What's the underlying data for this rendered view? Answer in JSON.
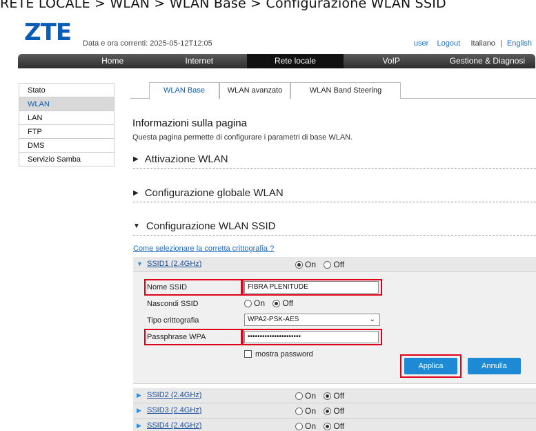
{
  "breadcrumb": "RETE LOCALE > WLAN > WLAN Base > Configurazione WLAN SSID",
  "logo": "ZTE",
  "datetime": "Data e ora correnti: 2025-05-12T12:05",
  "toplinks": {
    "user": "user",
    "logout": "Logout",
    "italiano": "Italiano",
    "sep": "|",
    "english": "English"
  },
  "nav": [
    "Home",
    "Internet",
    "Rete locale",
    "VoIP",
    "Gestione & Diagnosi"
  ],
  "sidebar": [
    "Stato",
    "WLAN",
    "LAN",
    "FTP",
    "DMS",
    "Servizio Samba"
  ],
  "tabs": [
    "WLAN Base",
    "WLAN avanzato",
    "WLAN Band Steering"
  ],
  "page": {
    "title": "Informazioni sulla pagina",
    "description": "Questa pagina permette di configurare i parametri di base WLAN."
  },
  "sections": [
    "Attivazione WLAN",
    "Configurazione globale WLAN",
    "Configurazione WLAN SSID"
  ],
  "help_link": "Come selezionare la corretta crittografia ?",
  "ssid1": {
    "name": "SSID1 (2.4GHz)",
    "on_label": "On",
    "off_label": "Off",
    "fields": {
      "ssid_name_label": "Nome SSID",
      "ssid_name_value": "FIBRA PLENITUDE",
      "hide_label": "Nascondi SSID",
      "encryption_label": "Tipo crittografia",
      "encryption_value": "WPA2-PSK-AES",
      "passphrase_label": "Passphrase WPA",
      "passphrase_value": "••••••••••••••••••••••",
      "show_password": "mostra password"
    },
    "apply": "Applica",
    "cancel": "Annulla"
  },
  "other_ssids": [
    {
      "name": "SSID2 (2.4GHz)"
    },
    {
      "name": "SSID3 (2.4GHz)"
    },
    {
      "name": "SSID4 (2.4GHz)"
    }
  ],
  "colors": {
    "accent": "#0a5db6",
    "button": "#1e8ad6",
    "highlight": "#e0001a"
  }
}
